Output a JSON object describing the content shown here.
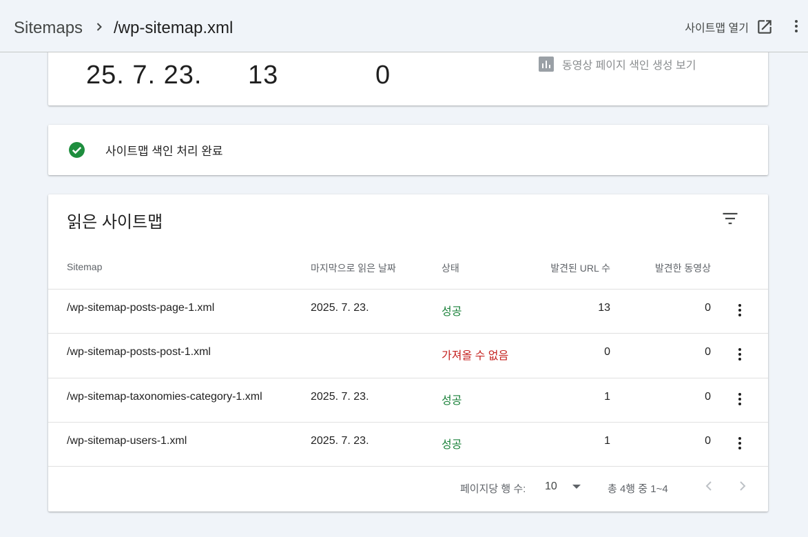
{
  "header": {
    "breadcrumb_root": "Sitemaps",
    "breadcrumb_current": "/wp-sitemap.xml",
    "open_sitemap_label": "사이트맵 열기"
  },
  "summary": {
    "last_read_date": "25. 7. 23.",
    "discovered_urls": "13",
    "discovered_videos": "0",
    "video_index_link": "동영상 페이지 색인 생성 보기"
  },
  "status_card": {
    "text": "사이트맵 색인 처리 완료"
  },
  "table": {
    "title": "읽은 사이트맵",
    "headers": [
      "Sitemap",
      "마지막으로 읽은 날짜",
      "상태",
      "발견된 URL 수",
      "발견한 동영상"
    ],
    "rows": [
      {
        "sitemap": "/wp-sitemap-posts-page-1.xml",
        "date": "2025. 7. 23.",
        "status": "성공",
        "urls": "13",
        "videos": "0"
      },
      {
        "sitemap": "/wp-sitemap-posts-post-1.xml",
        "date": "",
        "status": "가져올 수 없음",
        "urls": "0",
        "videos": "0"
      },
      {
        "sitemap": "/wp-sitemap-taxonomies-category-1.xml",
        "date": "2025. 7. 23.",
        "status": "성공",
        "urls": "1",
        "videos": "0"
      },
      {
        "sitemap": "/wp-sitemap-users-1.xml",
        "date": "2025. 7. 23.",
        "status": "성공",
        "urls": "1",
        "videos": "0"
      }
    ],
    "footer": {
      "rows_per_page_label": "페이지당 행 수:",
      "rows_per_page_value": "10",
      "range_text": "총 4행 중 1~4"
    }
  },
  "colors": {
    "success": "#188038",
    "error": "#c5221f",
    "status_check": "#1e8e3e",
    "background": "#f0f4f9"
  },
  "icons": [
    "chevron-right-icon",
    "open-in-new-icon",
    "more-vert-icon",
    "bar-chart-icon",
    "check-circle-icon",
    "filter-list-icon",
    "dropdown-arrow-icon",
    "chevron-left-icon"
  ]
}
